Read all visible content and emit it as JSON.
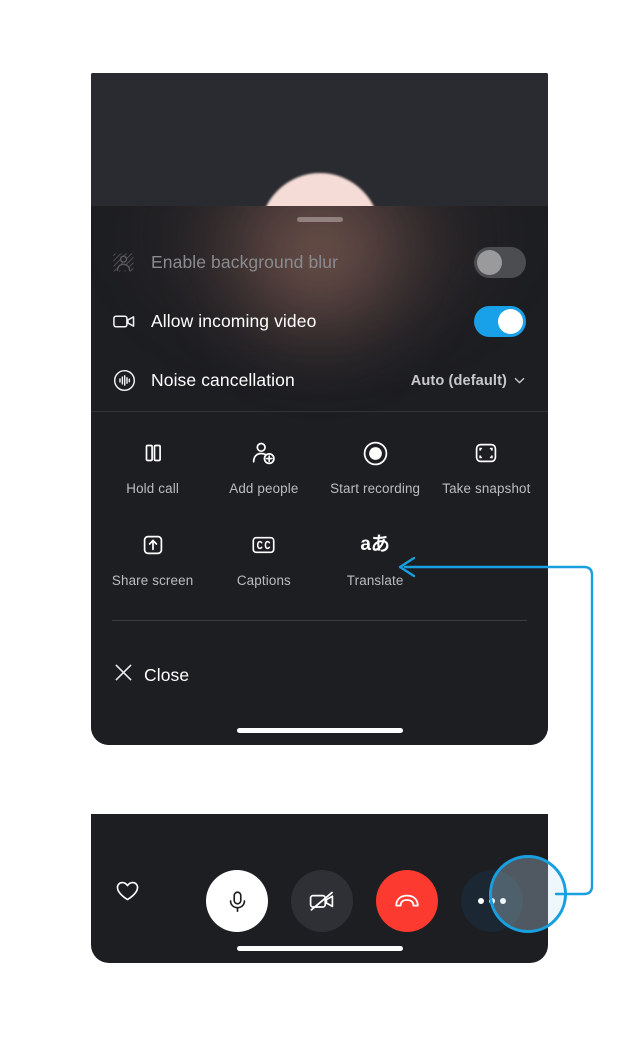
{
  "sheet": {
    "drag_handle": "drag-handle",
    "options": [
      {
        "icon": "background-blur-icon",
        "label": "Enable background blur",
        "control": "toggle",
        "state": "off",
        "disabled": true
      },
      {
        "icon": "video-camera-icon",
        "label": "Allow incoming video",
        "control": "toggle",
        "state": "on",
        "disabled": false
      },
      {
        "icon": "noise-cancellation-icon",
        "label": "Noise cancellation",
        "control": "select",
        "value": "Auto (default)",
        "disabled": false
      }
    ],
    "actions": [
      {
        "icon": "pause-icon",
        "label": "Hold call"
      },
      {
        "icon": "add-person-icon",
        "label": "Add people"
      },
      {
        "icon": "record-icon",
        "label": "Start recording"
      },
      {
        "icon": "snapshot-icon",
        "label": "Take snapshot"
      },
      {
        "icon": "share-screen-icon",
        "label": "Share screen"
      },
      {
        "icon": "closed-captions-icon",
        "label": "Captions"
      },
      {
        "icon": "translate-icon",
        "label": "Translate",
        "glyph": "aあ"
      }
    ],
    "close": {
      "icon": "close-x-icon",
      "label": "Close"
    }
  },
  "call_bar": {
    "buttons": [
      {
        "name": "reaction-heart-button",
        "icon": "heart-icon"
      },
      {
        "name": "microphone-button",
        "icon": "microphone-icon",
        "state": "active"
      },
      {
        "name": "camera-button",
        "icon": "camera-off-icon",
        "state": "off"
      },
      {
        "name": "end-call-button",
        "icon": "phone-hangup-icon"
      },
      {
        "name": "more-options-button",
        "icon": "ellipsis-icon",
        "state": "highlighted"
      }
    ]
  },
  "annotation": {
    "type": "callout-arrow",
    "from": "more-options-button",
    "to": "translate-icon",
    "color": "#189fe0"
  },
  "colors": {
    "sheet_bg": "#1d1e22",
    "backdrop_bg": "#2a2b30",
    "toggle_on": "#18a0e8",
    "toggle_off": "#4c4d51",
    "end_call_red": "#fc3a30",
    "accent_blue": "#189fe0",
    "text_primary": "#ffffff",
    "text_secondary": "#bcbdc1",
    "text_disabled": "#8b8b90"
  }
}
